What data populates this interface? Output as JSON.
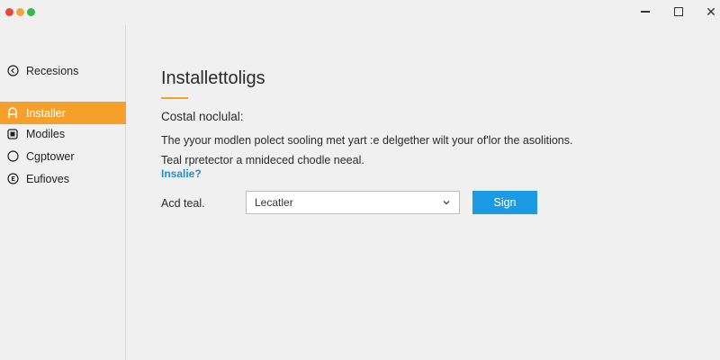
{
  "window": {
    "controls": [
      "minimize-icon",
      "maximize-icon",
      "close-icon"
    ],
    "close_glyph": "✕"
  },
  "colors": {
    "accent": "#f5a02b",
    "primary": "#1a9be4",
    "link": "#1f8fd6",
    "background": "#f0f0f0"
  },
  "sidebar": {
    "back": {
      "label": "Recesions",
      "icon": "back-circle-icon"
    },
    "items": [
      {
        "label": "Installer",
        "icon": "installer-icon",
        "active": true
      },
      {
        "label": "Modiles",
        "icon": "modules-icon",
        "active": false
      },
      {
        "label": "Cgptower",
        "icon": "circle-icon",
        "active": false
      },
      {
        "label": "Eufioves",
        "icon": "features-icon",
        "active": false
      }
    ]
  },
  "main": {
    "title": "Installettoligs",
    "section_heading": "Costal noclulal:",
    "description": "The yyour modlen polect sooling met yart :e delgether wilt your of'lor the asolitions.",
    "description2": "Teal rpretector a mnideced chodle neeal.",
    "link": "Insalie?",
    "field_label": "Acd teal.",
    "select_value": "Lecatler",
    "button_label": "Sign"
  }
}
